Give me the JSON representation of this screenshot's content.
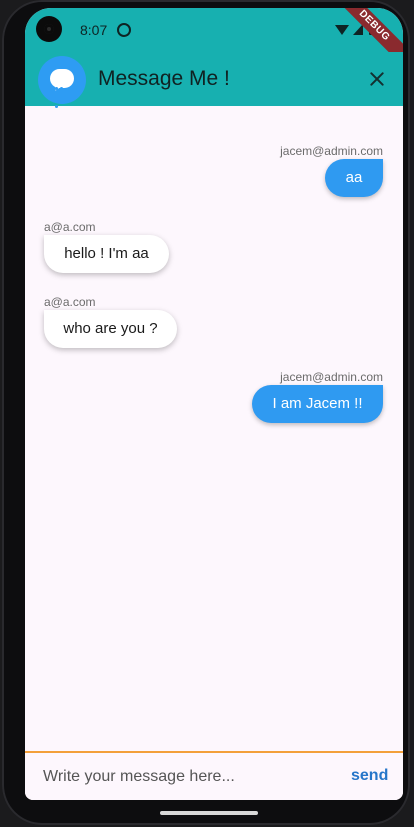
{
  "status_bar": {
    "time": "8:07",
    "debug_label": "DEBUG"
  },
  "app_bar": {
    "title": "Message Me !",
    "accent_color": "#17b0b0",
    "logo_color": "#2e9cf3"
  },
  "messages": [
    {
      "sender": "jacem@admin.com",
      "text": "aa",
      "outgoing": true
    },
    {
      "sender": "a@a.com",
      "text": "hello ! I'm aa",
      "outgoing": false
    },
    {
      "sender": "a@a.com",
      "text": "who are you ?",
      "outgoing": false
    },
    {
      "sender": "jacem@admin.com",
      "text": "I am Jacem !!",
      "outgoing": true
    }
  ],
  "composer": {
    "placeholder": "Write your message here...",
    "send_label": "send",
    "border_color": "#f3a03a"
  }
}
